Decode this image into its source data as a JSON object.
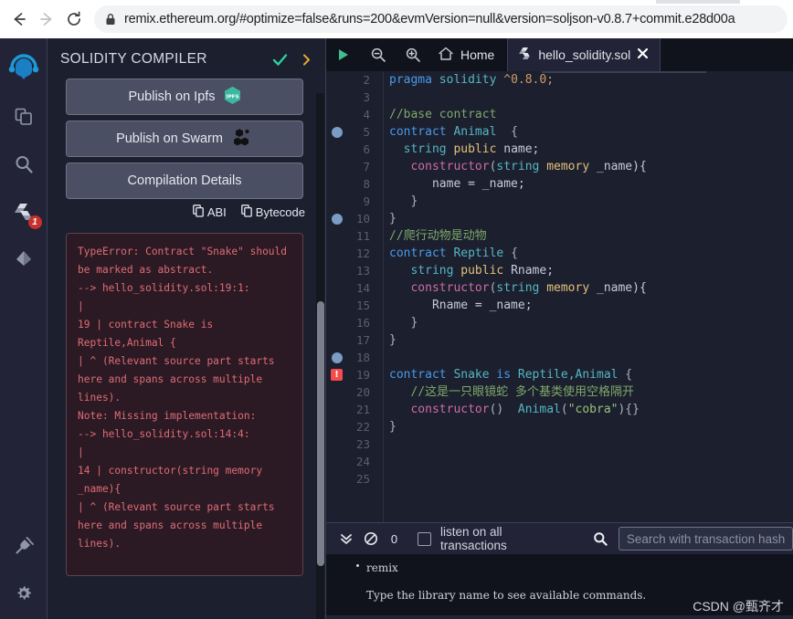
{
  "browser": {
    "back_label": "Back",
    "forward_label": "Forward",
    "reload_label": "Reload",
    "url": "remix.ethereum.org/#optimize=false&runs=200&evmVersion=null&version=soljson-v0.8.7+commit.e28d00a"
  },
  "rail": {
    "items": [
      {
        "name": "remix-logo",
        "label": "Remix"
      },
      {
        "name": "file-explorer",
        "label": "File explorers"
      },
      {
        "name": "search",
        "label": "Search in files"
      },
      {
        "name": "solidity-compiler",
        "label": "Solidity compiler",
        "badge": "1"
      },
      {
        "name": "deploy-run",
        "label": "Deploy & run transactions"
      }
    ],
    "bottom": [
      {
        "name": "plugin-manager",
        "label": "Plugin manager"
      },
      {
        "name": "settings",
        "label": "Settings"
      }
    ]
  },
  "panel": {
    "title": "SOLIDITY COMPILER",
    "status_icon": "check-icon",
    "expand_icon": "chevron-right-icon",
    "buttons": [
      {
        "label": "Publish on Ipfs",
        "icon": "ipfs-icon"
      },
      {
        "label": "Publish on Swarm",
        "icon": "swarm-icon"
      },
      {
        "label": "Compilation Details",
        "icon": ""
      }
    ],
    "links": [
      {
        "label": "ABI",
        "icon": "copy-icon"
      },
      {
        "label": "Bytecode",
        "icon": "copy-icon"
      }
    ],
    "error_text": "TypeError: Contract \"Snake\" should be marked as abstract.\n--> hello_solidity.sol:19:1:\n|\n19 | contract Snake is Reptile,Animal {\n| ^ (Relevant source part starts here and spans across multiple lines).\nNote: Missing implementation:\n--> hello_solidity.sol:14:4:\n|\n14 | constructor(string memory _name){\n| ^ (Relevant source part starts here and spans across multiple lines)."
  },
  "editor": {
    "toolbar": {
      "run_label": "Run",
      "zoom_out_label": "Zoom out",
      "zoom_in_label": "Zoom in",
      "home_label": "Home"
    },
    "tab": {
      "label": "hello_solidity.sol",
      "file_icon": "solidity-icon",
      "close_icon": "close-icon"
    },
    "first_visible_line": 2,
    "lines": [
      {
        "n": 2,
        "marker": "",
        "tokens": [
          {
            "t": "pragma ",
            "c": "t-key"
          },
          {
            "t": "solidity ",
            "c": "t-type"
          },
          {
            "t": "^0.8.0;",
            "c": "t-num"
          }
        ]
      },
      {
        "n": 3,
        "marker": "",
        "tokens": []
      },
      {
        "n": 4,
        "marker": "",
        "tokens": [
          {
            "t": "//base contract",
            "c": "t-cmt"
          }
        ]
      },
      {
        "n": 5,
        "marker": "dot",
        "tokens": [
          {
            "t": "contract ",
            "c": "t-key"
          },
          {
            "t": "Animal",
            "c": "t-type"
          },
          {
            "t": "  {",
            "c": "t-pun"
          }
        ]
      },
      {
        "n": 6,
        "marker": "",
        "tokens": [
          {
            "t": "  ",
            "c": "t-pun"
          },
          {
            "t": "string ",
            "c": "t-type"
          },
          {
            "t": "public ",
            "c": "t-mod"
          },
          {
            "t": "name;",
            "c": "t-var"
          }
        ]
      },
      {
        "n": 7,
        "marker": "",
        "tokens": [
          {
            "t": "   ",
            "c": "t-pun"
          },
          {
            "t": "constructor",
            "c": "t-fn"
          },
          {
            "t": "(",
            "c": "t-pun"
          },
          {
            "t": "string ",
            "c": "t-type"
          },
          {
            "t": "memory ",
            "c": "t-mod"
          },
          {
            "t": "_name){",
            "c": "t-var"
          }
        ]
      },
      {
        "n": 8,
        "marker": "",
        "tokens": [
          {
            "t": "      name = _name;",
            "c": "t-var"
          }
        ]
      },
      {
        "n": 9,
        "marker": "",
        "tokens": [
          {
            "t": "   }",
            "c": "t-pun"
          }
        ]
      },
      {
        "n": 10,
        "marker": "dot",
        "tokens": [
          {
            "t": "}",
            "c": "t-pun"
          }
        ]
      },
      {
        "n": 11,
        "marker": "",
        "tokens": [
          {
            "t": "//爬行动物是动物",
            "c": "t-cmt"
          }
        ]
      },
      {
        "n": 12,
        "marker": "",
        "tokens": [
          {
            "t": "contract ",
            "c": "t-key"
          },
          {
            "t": "Reptile",
            "c": "t-type"
          },
          {
            "t": " {",
            "c": "t-pun"
          }
        ]
      },
      {
        "n": 13,
        "marker": "",
        "tokens": [
          {
            "t": "   ",
            "c": "t-pun"
          },
          {
            "t": "string ",
            "c": "t-type"
          },
          {
            "t": "public ",
            "c": "t-mod"
          },
          {
            "t": "Rname;",
            "c": "t-var"
          }
        ]
      },
      {
        "n": 14,
        "marker": "",
        "tokens": [
          {
            "t": "   ",
            "c": "t-pun"
          },
          {
            "t": "constructor",
            "c": "t-fn"
          },
          {
            "t": "(",
            "c": "t-pun"
          },
          {
            "t": "string ",
            "c": "t-type"
          },
          {
            "t": "memory ",
            "c": "t-mod"
          },
          {
            "t": "_name){",
            "c": "t-var"
          }
        ]
      },
      {
        "n": 15,
        "marker": "",
        "tokens": [
          {
            "t": "      Rname = _name;",
            "c": "t-var"
          }
        ]
      },
      {
        "n": 16,
        "marker": "",
        "tokens": [
          {
            "t": "   }",
            "c": "t-pun"
          }
        ]
      },
      {
        "n": 17,
        "marker": "",
        "tokens": [
          {
            "t": "}",
            "c": "t-pun"
          }
        ]
      },
      {
        "n": 18,
        "marker": "dot",
        "tokens": []
      },
      {
        "n": 19,
        "marker": "error",
        "tokens": [
          {
            "t": "contract ",
            "c": "t-key"
          },
          {
            "t": "Snake ",
            "c": "t-type"
          },
          {
            "t": "is ",
            "c": "t-key"
          },
          {
            "t": "Reptile,Animal",
            "c": "t-type"
          },
          {
            "t": " {",
            "c": "t-pun"
          }
        ]
      },
      {
        "n": 20,
        "marker": "",
        "tokens": [
          {
            "t": "   //这是一只眼镜蛇 多个基类使用空格隔开",
            "c": "t-cmt"
          }
        ]
      },
      {
        "n": 21,
        "marker": "",
        "tokens": [
          {
            "t": "   ",
            "c": "t-pun"
          },
          {
            "t": "constructor",
            "c": "t-fn"
          },
          {
            "t": "()",
            "c": "t-pun"
          },
          {
            "t": "  Animal",
            "c": "t-type"
          },
          {
            "t": "(",
            "c": "t-pun"
          },
          {
            "t": "\"cobra\"",
            "c": "t-str"
          },
          {
            "t": "){}",
            "c": "t-pun"
          }
        ]
      },
      {
        "n": 22,
        "marker": "",
        "tokens": [
          {
            "t": "}",
            "c": "t-pun"
          }
        ]
      },
      {
        "n": 23,
        "marker": "",
        "tokens": []
      },
      {
        "n": 24,
        "marker": "",
        "tokens": []
      },
      {
        "n": 25,
        "marker": "",
        "tokens": []
      }
    ]
  },
  "terminal": {
    "collapse_icon": "double-chevron-down-icon",
    "clear_icon": "ban-icon",
    "pending_count": "0",
    "listen_label": "listen on all transactions",
    "listen_checked": false,
    "search_icon": "search-icon",
    "search_placeholder": "Search with transaction hash or address",
    "log_title": "remix",
    "log_body": "Type the library name to see available commands.",
    "watermark": "CSDN @甄齐才"
  },
  "colors": {
    "accent_teal": "#2ecfa0",
    "error_red": "#e06c75",
    "editor_bg": "#1b1f2e",
    "rail_bg": "#222336",
    "button_bg": "#4a4f63"
  }
}
